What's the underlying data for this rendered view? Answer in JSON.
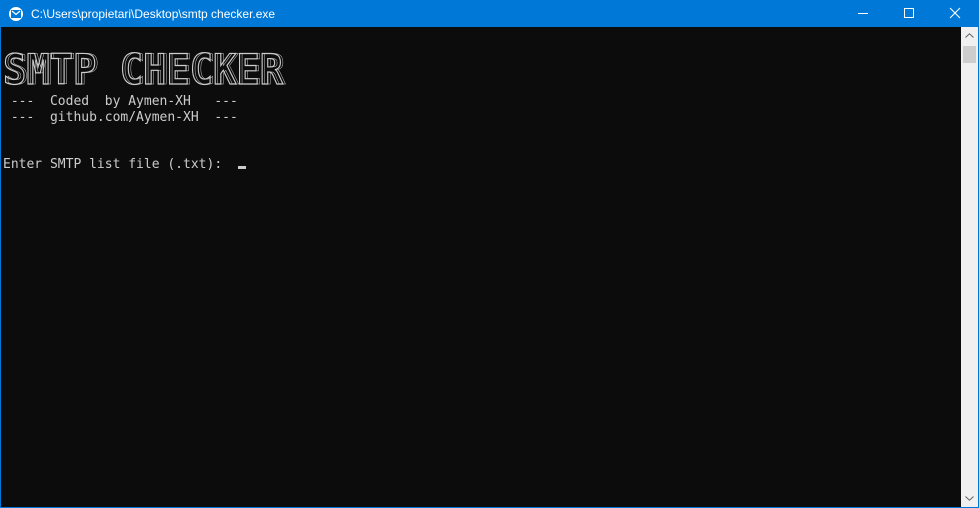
{
  "window": {
    "title": "C:\\Users\\propietari\\Desktop\\smtp checker.exe",
    "app_icon": "console-app-icon",
    "controls": {
      "minimize_icon": "minimize-icon",
      "maximize_icon": "maximize-icon",
      "close_icon": "close-icon"
    },
    "titlebar_color": "#0078d7"
  },
  "console": {
    "background_color": "#0c0c0c",
    "text_color": "#cccccc",
    "banner_text": "SMTP CHECKER",
    "lines": {
      "coded": " ---  Coded  by Aymen-XH   ---",
      "github": " ---  github.com/Aymen-XH  ---",
      "prompt": "Enter SMTP list file (.txt): "
    }
  }
}
